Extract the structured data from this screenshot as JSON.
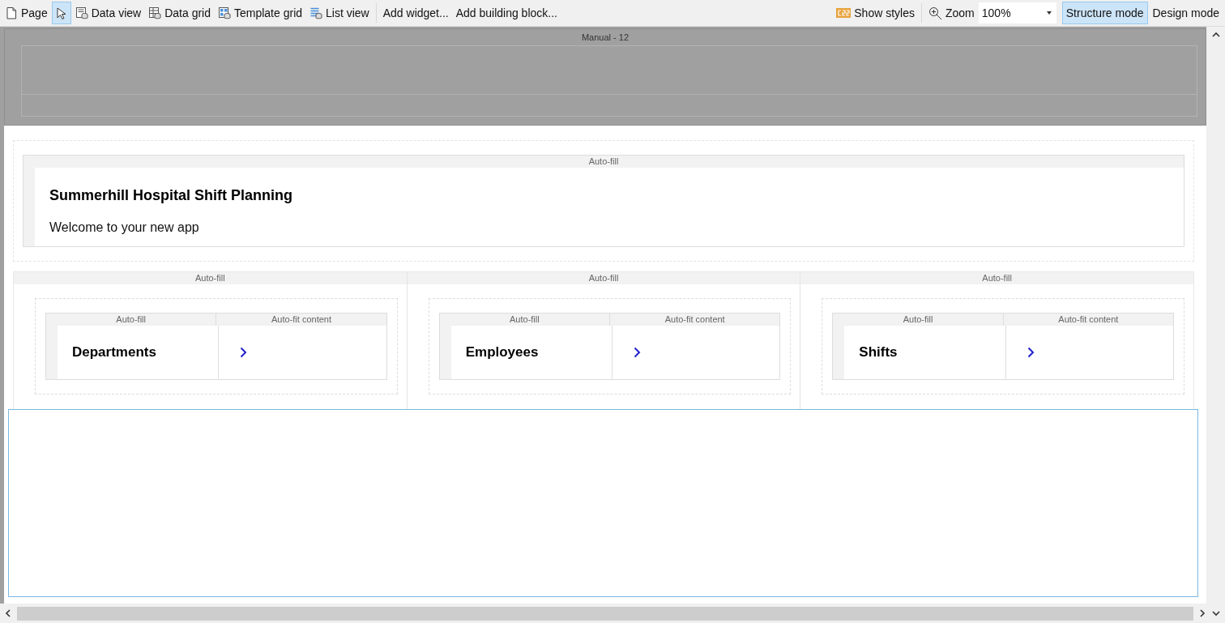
{
  "toolbar": {
    "tools": [
      {
        "kind": "page",
        "label": "Page",
        "selected": false
      },
      {
        "kind": "pointer",
        "selected": true
      },
      {
        "kind": "dataview",
        "label": "Data view",
        "selected": false
      },
      {
        "kind": "datagrid",
        "label": "Data grid",
        "selected": false
      },
      {
        "kind": "templategrid",
        "label": "Template grid",
        "selected": false
      },
      {
        "kind": "listview",
        "label": "List view",
        "selected": false
      },
      {
        "kind": "text",
        "label": "Add widget...",
        "selected": false
      },
      {
        "kind": "text",
        "label": "Add building block...",
        "selected": false
      }
    ],
    "show_styles": {
      "label": "Show styles"
    },
    "zoom": {
      "label": "Zoom",
      "value": "100%"
    },
    "modes": [
      {
        "label": "Structure mode",
        "selected": true
      },
      {
        "label": "Design mode",
        "selected": false
      }
    ]
  },
  "canvas": {
    "layout_header": {
      "label": "Manual - 12"
    },
    "header_block": {
      "label": "Auto-fill",
      "title": "Summerhill Hospital Shift Planning",
      "subtitle": "Welcome to your new app"
    },
    "columns": [
      {
        "label": "Auto-fill",
        "card": {
          "left_label": "Auto-fill",
          "right_label": "Auto-fit content",
          "title": "Departments"
        }
      },
      {
        "label": "Auto-fill",
        "card": {
          "left_label": "Auto-fill",
          "right_label": "Auto-fit content",
          "title": "Employees"
        }
      },
      {
        "label": "Auto-fill",
        "card": {
          "left_label": "Auto-fill",
          "right_label": "Auto-fit content",
          "title": "Shifts"
        }
      }
    ]
  }
}
